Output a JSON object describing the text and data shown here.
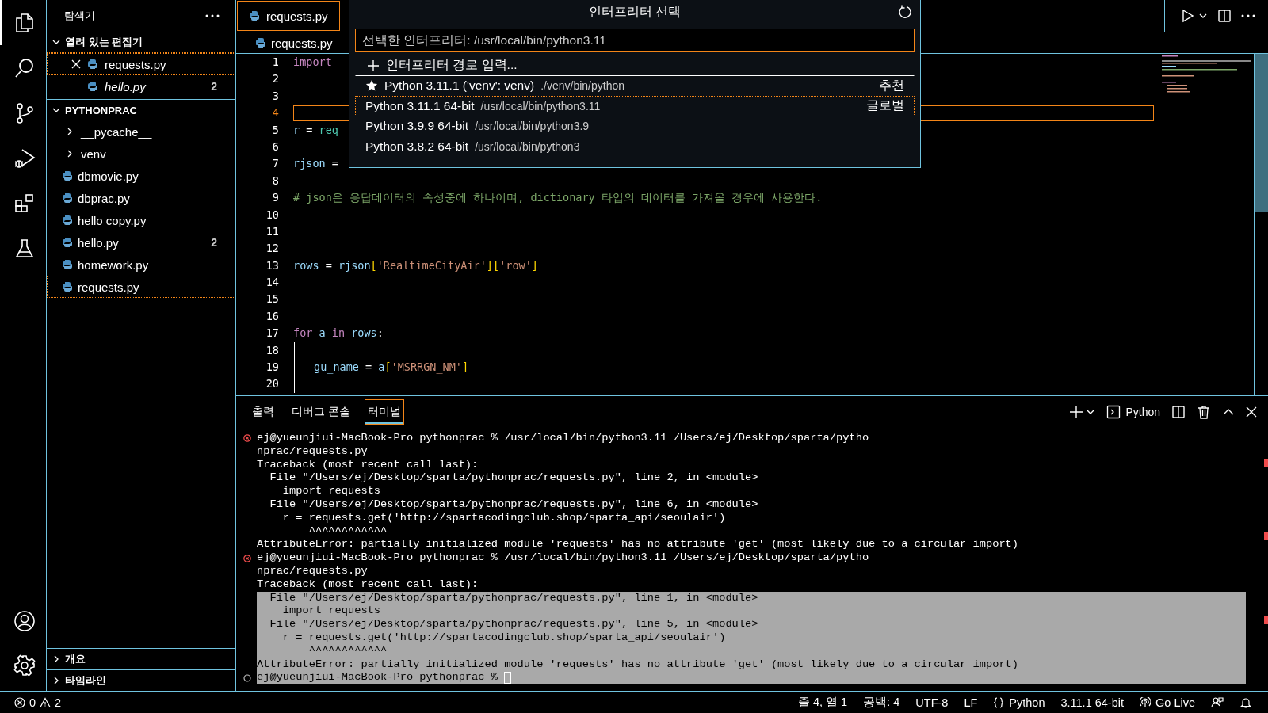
{
  "activity_bar": {
    "items": [
      {
        "selected": true
      },
      {
        "selected": false
      },
      {
        "selected": false
      },
      {
        "selected": false
      },
      {
        "selected": false
      },
      {
        "selected": false
      }
    ],
    "bottom_items": [
      {
        "selected": false
      },
      {
        "selected": false
      }
    ]
  },
  "explorer": {
    "title": "탐색기",
    "sections": [
      {
        "title": "열려 있는 편집기",
        "expanded": true,
        "items": [
          {
            "name": "requests.py",
            "kind": "file",
            "focused": true,
            "preview": false,
            "closable": true
          },
          {
            "name": "hello.py",
            "kind": "file",
            "focused": false,
            "preview": true,
            "closable": false,
            "badge": "2"
          }
        ]
      },
      {
        "title": "PYTHONPRAC",
        "expanded": true,
        "items": [
          {
            "name": "__pycache__",
            "kind": "folder",
            "expanded": false,
            "focused": false
          },
          {
            "name": "venv",
            "kind": "folder",
            "expanded": false,
            "focused": false
          },
          {
            "name": "dbmovie.py",
            "kind": "file",
            "focused": false
          },
          {
            "name": "dbprac.py",
            "kind": "file",
            "focused": false
          },
          {
            "name": "hello copy.py",
            "kind": "file",
            "focused": false
          },
          {
            "name": "hello.py",
            "kind": "file",
            "focused": false,
            "badge": "2"
          },
          {
            "name": "homework.py",
            "kind": "file",
            "focused": false
          },
          {
            "name": "requests.py",
            "kind": "file",
            "focused": true
          }
        ]
      }
    ],
    "bottom_sections": [
      {
        "title": "개요",
        "expanded": false
      },
      {
        "title": "타임라인",
        "expanded": false
      }
    ]
  },
  "editor": {
    "tabs": [
      {
        "label": "requests.py",
        "selected": true
      }
    ],
    "breadcrumb": [
      "requests.py"
    ],
    "lines": [
      {
        "number": "1",
        "current": false,
        "indented": false,
        "tokens": [
          {
            "t": "import",
            "kind": "keyword"
          }
        ]
      },
      {
        "number": "2",
        "current": false,
        "indented": false
      },
      {
        "number": "3",
        "current": false,
        "indented": false
      },
      {
        "number": "4",
        "current": true,
        "indented": false
      },
      {
        "number": "5",
        "current": false,
        "indented": false,
        "tokens": [
          {
            "t": "r",
            "kind": "var"
          },
          {
            "t": " = ",
            "kind": "plain"
          },
          {
            "t": "req",
            "kind": "module"
          }
        ]
      },
      {
        "number": "6",
        "current": false,
        "indented": false
      },
      {
        "number": "7",
        "current": false,
        "indented": false,
        "tokens": [
          {
            "t": "rjson",
            "kind": "var"
          },
          {
            "t": " =",
            "kind": "plain"
          }
        ]
      },
      {
        "number": "8",
        "current": false,
        "indented": false
      },
      {
        "number": "9",
        "current": false,
        "indented": false,
        "tokens": [
          {
            "t": "# json은 응답데이터의 속성중에 하나이며, dictionary 타입의 데이터를 가져올 경우에 사용한다.",
            "kind": "comment"
          }
        ]
      },
      {
        "number": "10",
        "current": false,
        "indented": false
      },
      {
        "number": "11",
        "current": false,
        "indented": false
      },
      {
        "number": "12",
        "current": false,
        "indented": false
      },
      {
        "number": "13",
        "current": false,
        "indented": false,
        "tokens": [
          {
            "t": "rows",
            "kind": "var"
          },
          {
            "t": " = ",
            "kind": "plain"
          },
          {
            "t": "rjson",
            "kind": "var"
          },
          {
            "t": "[",
            "kind": "bracket"
          },
          {
            "t": "'RealtimeCityAir'",
            "kind": "string"
          },
          {
            "t": "][",
            "kind": "bracket"
          },
          {
            "t": "'row'",
            "kind": "string"
          },
          {
            "t": "]",
            "kind": "bracket"
          }
        ]
      },
      {
        "number": "14",
        "current": false,
        "indented": false
      },
      {
        "number": "15",
        "current": false,
        "indented": false
      },
      {
        "number": "16",
        "current": false,
        "indented": false
      },
      {
        "number": "17",
        "current": false,
        "indented": false,
        "tokens": [
          {
            "t": "for ",
            "kind": "keyword"
          },
          {
            "t": "a ",
            "kind": "var"
          },
          {
            "t": "in ",
            "kind": "keyword"
          },
          {
            "t": "rows",
            "kind": "var"
          },
          {
            "t": ":",
            "kind": "plain"
          }
        ]
      },
      {
        "number": "18",
        "current": false,
        "indented": true
      },
      {
        "number": "19",
        "current": false,
        "indented": true,
        "tokens": [
          {
            "t": "gu_name",
            "kind": "var"
          },
          {
            "t": " = ",
            "kind": "plain"
          },
          {
            "t": "a",
            "kind": "var"
          },
          {
            "t": "[",
            "kind": "bracket"
          },
          {
            "t": "'MSRRGN_NM'",
            "kind": "string"
          },
          {
            "t": "]",
            "kind": "bracket"
          }
        ]
      },
      {
        "number": "20",
        "current": false,
        "indented": true
      }
    ]
  },
  "quick_pick": {
    "title": "인터프리터 선택",
    "placeholder": "선택한 인터프리터: /usr/local/bin/python3.11",
    "items": [
      {
        "kind": "add",
        "label": "인터프리터 경로 입력...",
        "selected": false
      },
      {
        "kind": "recommended",
        "label": "Python 3.11.1 ('venv': venv)",
        "detail": "./venv/bin/python",
        "tag": "추천",
        "selected": false
      },
      {
        "kind": "interpreter",
        "label": "Python 3.11.1 64-bit",
        "detail": "/usr/local/bin/python3.11",
        "tag": "글로벌",
        "selected": true
      },
      {
        "kind": "interpreter",
        "label": "Python 3.9.9 64-bit",
        "detail": "/usr/local/bin/python3.9",
        "selected": false
      },
      {
        "kind": "interpreter",
        "label": "Python 3.8.2 64-bit",
        "detail": "/usr/local/bin/python3",
        "selected": false
      }
    ]
  },
  "panel": {
    "tabs": [
      {
        "label": "출력",
        "selected": false
      },
      {
        "label": "디버그 콘솔",
        "selected": false
      },
      {
        "label": "터미널",
        "selected": true
      }
    ],
    "terminal_name": "Python",
    "terminal": {
      "cursor": true,
      "lines": [
        {
          "kind": "error-prompt",
          "highlighted": false,
          "text": "ej@yueunjiui-MacBook-Pro pythonprac % /usr/local/bin/python3.11 /Users/ej/Desktop/sparta/pytho"
        },
        {
          "kind": "output",
          "highlighted": false,
          "text": "nprac/requests.py"
        },
        {
          "kind": "output",
          "highlighted": false,
          "text": "Traceback (most recent call last):"
        },
        {
          "kind": "output",
          "highlighted": false,
          "text": "  File \"/Users/ej/Desktop/sparta/pythonprac/requests.py\", line 2, in <module>"
        },
        {
          "kind": "output",
          "highlighted": false,
          "text": "    import requests"
        },
        {
          "kind": "output",
          "highlighted": false,
          "text": "  File \"/Users/ej/Desktop/sparta/pythonprac/requests.py\", line 6, in <module>"
        },
        {
          "kind": "output",
          "highlighted": false,
          "text": "    r = requests.get('http://spartacodingclub.shop/sparta_api/seoulair')"
        },
        {
          "kind": "output",
          "highlighted": false,
          "text": "        ^^^^^^^^^^^^"
        },
        {
          "kind": "output",
          "highlighted": false,
          "text": "AttributeError: partially initialized module 'requests' has no attribute 'get' (most likely due to a circular import)"
        },
        {
          "kind": "error-prompt",
          "highlighted": false,
          "text": "ej@yueunjiui-MacBook-Pro pythonprac % /usr/local/bin/python3.11 /Users/ej/Desktop/sparta/pytho"
        },
        {
          "kind": "output",
          "highlighted": false,
          "text": "nprac/requests.py"
        },
        {
          "kind": "output",
          "highlighted": false,
          "text": "Traceback (most recent call last):"
        },
        {
          "kind": "output",
          "highlighted": true,
          "text": "  File \"/Users/ej/Desktop/sparta/pythonprac/requests.py\", line 1, in <module>"
        },
        {
          "kind": "output",
          "highlighted": true,
          "text": "    import requests"
        },
        {
          "kind": "output",
          "highlighted": true,
          "text": "  File \"/Users/ej/Desktop/sparta/pythonprac/requests.py\", line 5, in <module>"
        },
        {
          "kind": "output",
          "highlighted": true,
          "text": "    r = requests.get('http://spartacodingclub.shop/sparta_api/seoulair')"
        },
        {
          "kind": "output",
          "highlighted": true,
          "text": "        ^^^^^^^^^^^^"
        },
        {
          "kind": "output",
          "highlighted": true,
          "text": "AttributeError: partially initialized module 'requests' has no attribute 'get' (most likely due to a circular import)"
        },
        {
          "kind": "idle-prompt",
          "highlighted": true,
          "text": "ej@yueunjiui-MacBook-Pro pythonprac %"
        }
      ]
    }
  },
  "status_bar": {
    "errors": "0",
    "warnings": "2",
    "items": [
      {
        "kind": "text",
        "text": "줄 4, 열 1"
      },
      {
        "kind": "text",
        "text": "공백: 4"
      },
      {
        "kind": "text",
        "text": "UTF-8"
      },
      {
        "kind": "text",
        "text": "LF"
      },
      {
        "kind": "language",
        "text": "Python"
      },
      {
        "kind": "text",
        "text": "3.11.1 64-bit"
      },
      {
        "kind": "broadcast",
        "text": "Go Live"
      },
      {
        "kind": "feedback"
      },
      {
        "kind": "bell"
      }
    ]
  }
}
